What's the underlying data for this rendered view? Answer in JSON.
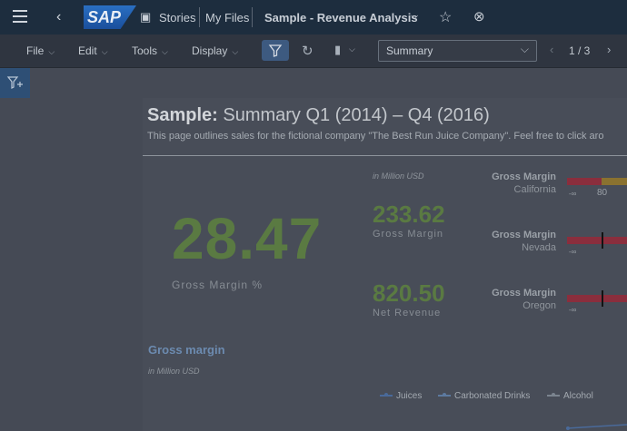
{
  "shell": {
    "stories_label": "Stories",
    "myfiles_label": "My Files",
    "title": "Sample - Revenue Analysis",
    "logo_text": "SAP"
  },
  "toolbar": {
    "file": "File",
    "edit": "Edit",
    "tools": "Tools",
    "display": "Display",
    "page_select": "Summary",
    "page_num": "1 / 3"
  },
  "story": {
    "title_bold": "Sample:",
    "title_rest": " Summary Q1 (2014) – Q4 (2016)",
    "subtitle": "This page outlines sales for the fictional company \"The Best Run Juice Company\". Feel free to click aro",
    "big_value": "28.47",
    "big_label": "Gross Margin %",
    "unit": "in Million USD",
    "gross_margin_value": "233.62",
    "gross_margin_label": "Gross Margin",
    "net_revenue_value": "820.50",
    "net_revenue_label": "Net Revenue",
    "gm_items": [
      {
        "title": "Gross Margin",
        "region": "California",
        "scale": "80"
      },
      {
        "title": "Gross Margin",
        "region": "Nevada"
      },
      {
        "title": "Gross Margin",
        "region": "Oregon"
      }
    ],
    "section_title": "Gross margin",
    "section_unit": "in Million USD",
    "legend": [
      "Juices",
      "Carbonated Drinks",
      "Alcohol"
    ]
  },
  "colors": {
    "kpi_green": "#5a7a42",
    "shell_bg": "#1d2d3e",
    "legend_juices": "#4a6a9a",
    "legend_carbonated": "#5d7aa0",
    "legend_alcohol": "#7b848f"
  }
}
